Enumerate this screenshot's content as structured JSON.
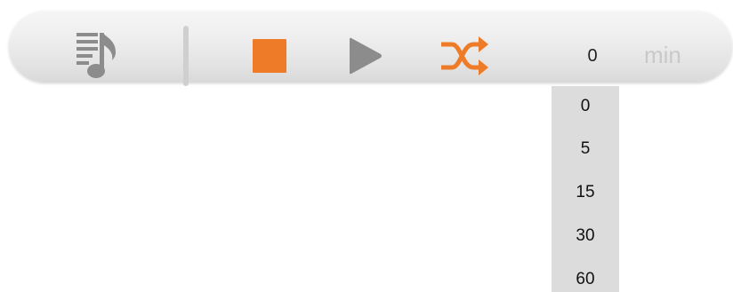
{
  "toolbar": {
    "buttons": {
      "playlist_icon": "playlist-music-icon",
      "stop_icon": "stop-icon",
      "play_icon": "play-icon",
      "shuffle_icon": "shuffle-icon"
    },
    "timer": {
      "value": "0",
      "unit": "min"
    }
  },
  "timer_dropdown": {
    "options": [
      "0",
      "5",
      "15",
      "30",
      "60"
    ]
  },
  "colors": {
    "accent": "#ee7b27",
    "icon_gray": "#8c8c8c",
    "toolbar_bg": "#e8e8e8",
    "dropdown_bg": "#dcdcdc",
    "unit_text": "#c9c9c9"
  }
}
